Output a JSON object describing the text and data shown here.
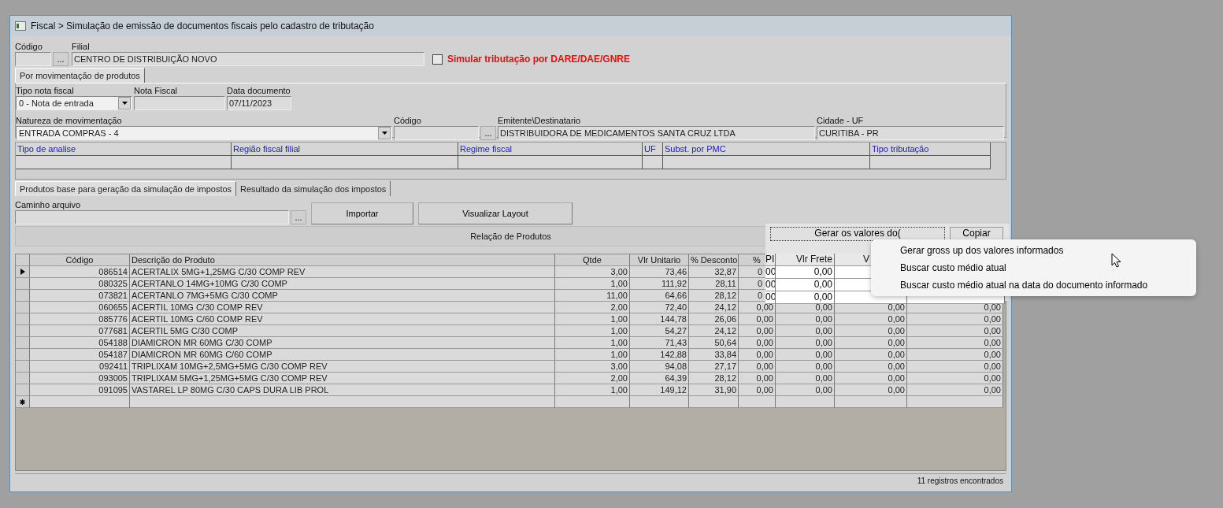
{
  "window": {
    "title": "Fiscal > Simulação de emissão de documentos fiscais pelo cadastro de tributação"
  },
  "header": {
    "codigo_label": "Código",
    "lookup": "...",
    "filial_label": "Filial",
    "filial_value": "CENTRO DE DISTRIBUIÇÃO NOVO",
    "dare": {
      "label": "Simular tributação por DARE/DAE/GNRE",
      "checked": false
    }
  },
  "top_tabs": [
    {
      "label": "Por movimentação de produtos",
      "selected": true
    }
  ],
  "field_rows": [
    [
      {
        "kind": "select",
        "label": "Tipo nota fiscal",
        "value": "0 - Nota de entrada"
      },
      {
        "kind": "text",
        "label": "Nota Fiscal"
      },
      {
        "kind": "text",
        "label": "Data documento",
        "value": "07/11/2023"
      }
    ],
    [
      {
        "kind": "select",
        "label": "Natureza de movimentação",
        "value": "ENTRADA COMPRAS - 4"
      },
      {
        "kind": "lookup",
        "label": "Código",
        "lookup": "..."
      },
      {
        "kind": "text",
        "label": "Emitente\\Destinatario",
        "value": "DISTRIBUIDORA DE MEDICAMENTOS SANTA CRUZ LTDA"
      },
      {
        "kind": "text",
        "label": "Cidade - UF",
        "value": "CURITIBA - PR"
      }
    ]
  ],
  "info_grid": {
    "columns": [
      "Tipo de analise",
      "Região fiscal filial",
      "Regime fiscal",
      "UF",
      "Subst. por PMC",
      "Tipo tributação"
    ]
  },
  "product_tabs": [
    {
      "label": "Produtos base para geração da simulação de impostos",
      "selected": true
    },
    {
      "label": "Resultado da simulação dos impostos",
      "selected": false
    }
  ],
  "file": {
    "label": "Caminho arquivo",
    "browse": "...",
    "buttons": [
      "Importar",
      "Visualizar Layout"
    ]
  },
  "section_title": "Relação de Produtos",
  "table": {
    "columns": [
      "Código",
      "Descrição do Produto",
      "Qtde",
      "Vlr Unitario",
      "% Desconto",
      "%",
      null,
      null,
      null
    ],
    "rows": [
      {
        "selected": true,
        "cells": [
          "086514",
          "ACERTALIX 5MG+1,25MG C/30 COMP REV",
          "3,00",
          "73,46",
          "32,87",
          "0",
          null,
          null,
          null
        ]
      },
      {
        "selected": false,
        "cells": [
          "080325",
          "ACERTANLO 14MG+10MG C/30 COMP",
          "1,00",
          "111,92",
          "28,11",
          "0",
          null,
          null,
          null
        ]
      },
      {
        "selected": false,
        "cells": [
          "073821",
          "ACERTANLO 7MG+5MG C/30 COMP",
          "11,00",
          "64,66",
          "28,12",
          "0",
          null,
          null,
          null
        ]
      },
      {
        "selected": false,
        "cells": [
          "060655",
          "ACERTIL 10MG C/30 COMP REV",
          "2,00",
          "72,40",
          "24,12",
          "0,00",
          "0,00",
          "0,00",
          "0,00"
        ]
      },
      {
        "selected": false,
        "cells": [
          "085776",
          "ACERTIL 10MG C/60 COMP REV",
          "1,00",
          "144,78",
          "26,06",
          "0,00",
          "0,00",
          "0,00",
          "0,00"
        ]
      },
      {
        "selected": false,
        "cells": [
          "077681",
          "ACERTIL 5MG C/30 COMP",
          "1,00",
          "54,27",
          "24,12",
          "0,00",
          "0,00",
          "0,00",
          "0,00"
        ]
      },
      {
        "selected": false,
        "cells": [
          "054188",
          "DIAMICRON MR 60MG C/30 COMP",
          "1,00",
          "71,43",
          "50,64",
          "0,00",
          "0,00",
          "0,00",
          "0,00"
        ]
      },
      {
        "selected": false,
        "cells": [
          "054187",
          "DIAMICRON MR 60MG C/60 COMP",
          "1,00",
          "142,88",
          "33,84",
          "0,00",
          "0,00",
          "0,00",
          "0,00"
        ]
      },
      {
        "selected": false,
        "cells": [
          "092411",
          "TRIPLIXAM 10MG+2,5MG+5MG C/30 COMP REV",
          "3,00",
          "94,08",
          "27,17",
          "0,00",
          "0,00",
          "0,00",
          "0,00"
        ]
      },
      {
        "selected": false,
        "cells": [
          "093005",
          "TRIPLIXAM 5MG+1,25MG+5MG C/30 COMP REV",
          "2,00",
          "64,39",
          "28,12",
          "0,00",
          "0,00",
          "0,00",
          "0,00"
        ]
      },
      {
        "selected": false,
        "cells": [
          "091095",
          "VASTAREL LP 80MG C/30 CAPS DURA LIB PROL",
          "1,00",
          "149,12",
          "31,90",
          "0,00",
          "0,00",
          "0,00",
          "0,00"
        ]
      }
    ]
  },
  "status_bar": "11 registros encontrados",
  "overlay": {
    "buttons": [
      "Gerar os valores do(",
      "Copiar"
    ],
    "columns": [
      "PI",
      "Vlr Frete",
      "V"
    ],
    "rows": [
      [
        "00",
        "0,00"
      ],
      [
        "00",
        "0,00"
      ],
      [
        "00",
        "0,00"
      ]
    ]
  },
  "context_menu": {
    "items": [
      "Gerar gross up dos valores informados",
      "Buscar custo médio atual",
      "Buscar custo médio atual na data do documento informado"
    ]
  }
}
